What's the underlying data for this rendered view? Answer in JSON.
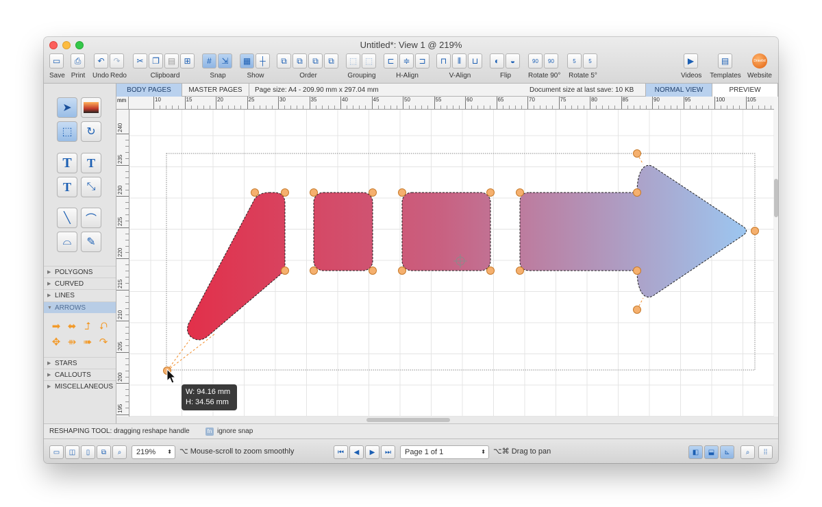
{
  "window": {
    "title": "Untitled*: View 1 @ 219%"
  },
  "toolbar": {
    "save": "Save",
    "print": "Print",
    "undo": "Undo",
    "redo": "Redo",
    "clipboard": "Clipboard",
    "snap": "Snap",
    "show": "Show",
    "order": "Order",
    "grouping": "Grouping",
    "halign": "H-Align",
    "valign": "V-Align",
    "flip": "Flip",
    "rotate90": "Rotate 90°",
    "rotate5": "Rotate 5°",
    "videos": "Videos",
    "templates": "Templates",
    "website": "Website",
    "website_badge": "Drawbd",
    "rotate90_glyph": "90",
    "rotate5_glyph": "5"
  },
  "tabs": {
    "body_pages": "BODY PAGES",
    "master_pages": "MASTER PAGES",
    "page_size": "Page size:   A4 - 209.90 mm x 297.04 mm",
    "doc_size": "Document size at last save:  10 KB",
    "normal_view": "NORMAL VIEW",
    "preview": "PREVIEW"
  },
  "ruler": {
    "unit": "mm",
    "h_ticks": [
      "10",
      "15",
      "20",
      "25",
      "30",
      "35",
      "40",
      "45",
      "50",
      "55",
      "60",
      "65",
      "70",
      "75",
      "80",
      "85",
      "90",
      "95",
      "100",
      "105"
    ],
    "v_ticks": [
      "240",
      "235",
      "230",
      "225",
      "220",
      "215",
      "210",
      "205",
      "200",
      "195"
    ]
  },
  "categories": {
    "polygons": "POLYGONS",
    "curved": "CURVED",
    "lines": "LINES",
    "arrows": "ARROWS",
    "stars": "STARS",
    "callouts": "CALLOUTS",
    "misc": "MISCELLANEOUS"
  },
  "tooltip": {
    "w": "W: 94.16 mm",
    "h": "H: 34.56 mm"
  },
  "status": {
    "tool": "RESHAPING TOOL:  dragging reshape handle",
    "key": "fn",
    "snap": "ignore snap"
  },
  "bottom": {
    "zoom": "219%",
    "zoom_hint": "⌥ Mouse-scroll to zoom smoothly",
    "page": "Page 1 of 1",
    "pan_hint": "⌥⌘ Drag to pan"
  },
  "icons": {
    "select": "arrow-pointer-icon",
    "image_select": "image-select-icon",
    "reshape": "reshape-icon",
    "rotate": "rotate-icon",
    "text": "text-icon",
    "text_add": "text-add-icon",
    "text_flow": "text-flow-icon",
    "connector": "connector-icon",
    "line": "line-icon",
    "curve": "curve-icon",
    "bezier": "bezier-icon",
    "pencil": "pencil-icon"
  },
  "colors": {
    "accent": "#b9d1ee",
    "shape_start": "#e0304a",
    "shape_end": "#a0c4ee",
    "handle": "#f2a65a"
  }
}
